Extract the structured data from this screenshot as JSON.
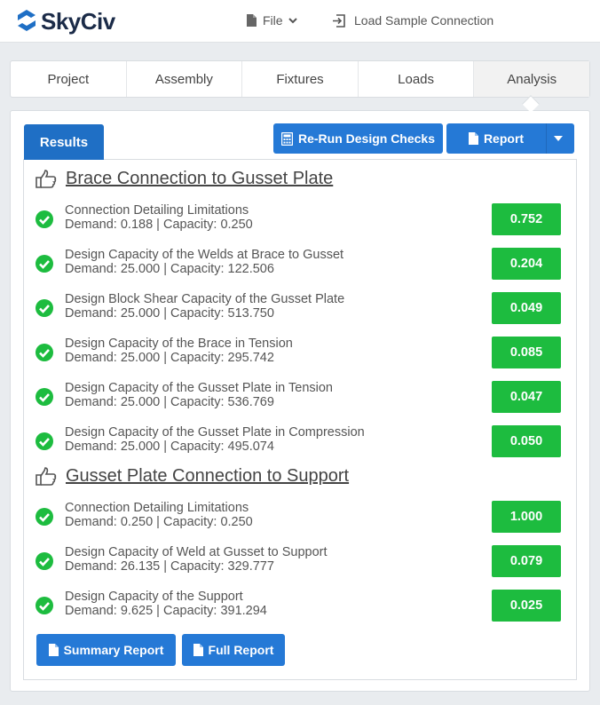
{
  "header": {
    "logo_text": "SkyCiv",
    "file_menu_label": "File",
    "load_sample_label": "Load Sample Connection"
  },
  "tabs": [
    {
      "label": "Project"
    },
    {
      "label": "Assembly"
    },
    {
      "label": "Fixtures"
    },
    {
      "label": "Loads"
    },
    {
      "label": "Analysis",
      "active": true
    }
  ],
  "panel": {
    "results_tab_label": "Results",
    "rerun_label": "Re-Run Design Checks",
    "report_label": "Report",
    "summary_report_label": "Summary Report",
    "full_report_label": "Full Report"
  },
  "sections": [
    {
      "title": "Brace Connection to Gusset Plate",
      "checks": [
        {
          "title": "Connection Detailing Limitations",
          "detail": "Demand: 0.188 | Capacity: 0.250",
          "ratio": "0.752"
        },
        {
          "title": "Design Capacity of the Welds at Brace to Gusset",
          "detail": "Demand: 25.000 | Capacity: 122.506",
          "ratio": "0.204"
        },
        {
          "title": "Design Block Shear Capacity of the Gusset Plate",
          "detail": "Demand: 25.000 | Capacity: 513.750",
          "ratio": "0.049"
        },
        {
          "title": "Design Capacity of the Brace in Tension",
          "detail": "Demand: 25.000 | Capacity: 295.742",
          "ratio": "0.085"
        },
        {
          "title": "Design Capacity of the Gusset Plate in Tension",
          "detail": "Demand: 25.000 | Capacity: 536.769",
          "ratio": "0.047"
        },
        {
          "title": "Design Capacity of the Gusset Plate in Compression",
          "detail": "Demand: 25.000 | Capacity: 495.074",
          "ratio": "0.050"
        }
      ]
    },
    {
      "title": "Gusset Plate Connection to Support",
      "checks": [
        {
          "title": "Connection Detailing Limitations",
          "detail": "Demand: 0.250 | Capacity: 0.250",
          "ratio": "1.000"
        },
        {
          "title": "Design Capacity of Weld at Gusset to Support",
          "detail": "Demand: 26.135 | Capacity: 329.777",
          "ratio": "0.079"
        },
        {
          "title": "Design Capacity of the Support",
          "detail": "Demand: 9.625 | Capacity: 391.294",
          "ratio": "0.025"
        }
      ]
    }
  ],
  "colors": {
    "brand_blue": "#2579d6",
    "pass_green": "#1dbc3f",
    "results_tab": "#1f6fc5"
  },
  "icons": [
    "skyciv-logo-icon",
    "file-icon",
    "chevron-down-icon",
    "import-icon",
    "calculator-icon",
    "document-icon",
    "caret-down-icon",
    "thumbs-up-icon",
    "check-circle-icon"
  ]
}
